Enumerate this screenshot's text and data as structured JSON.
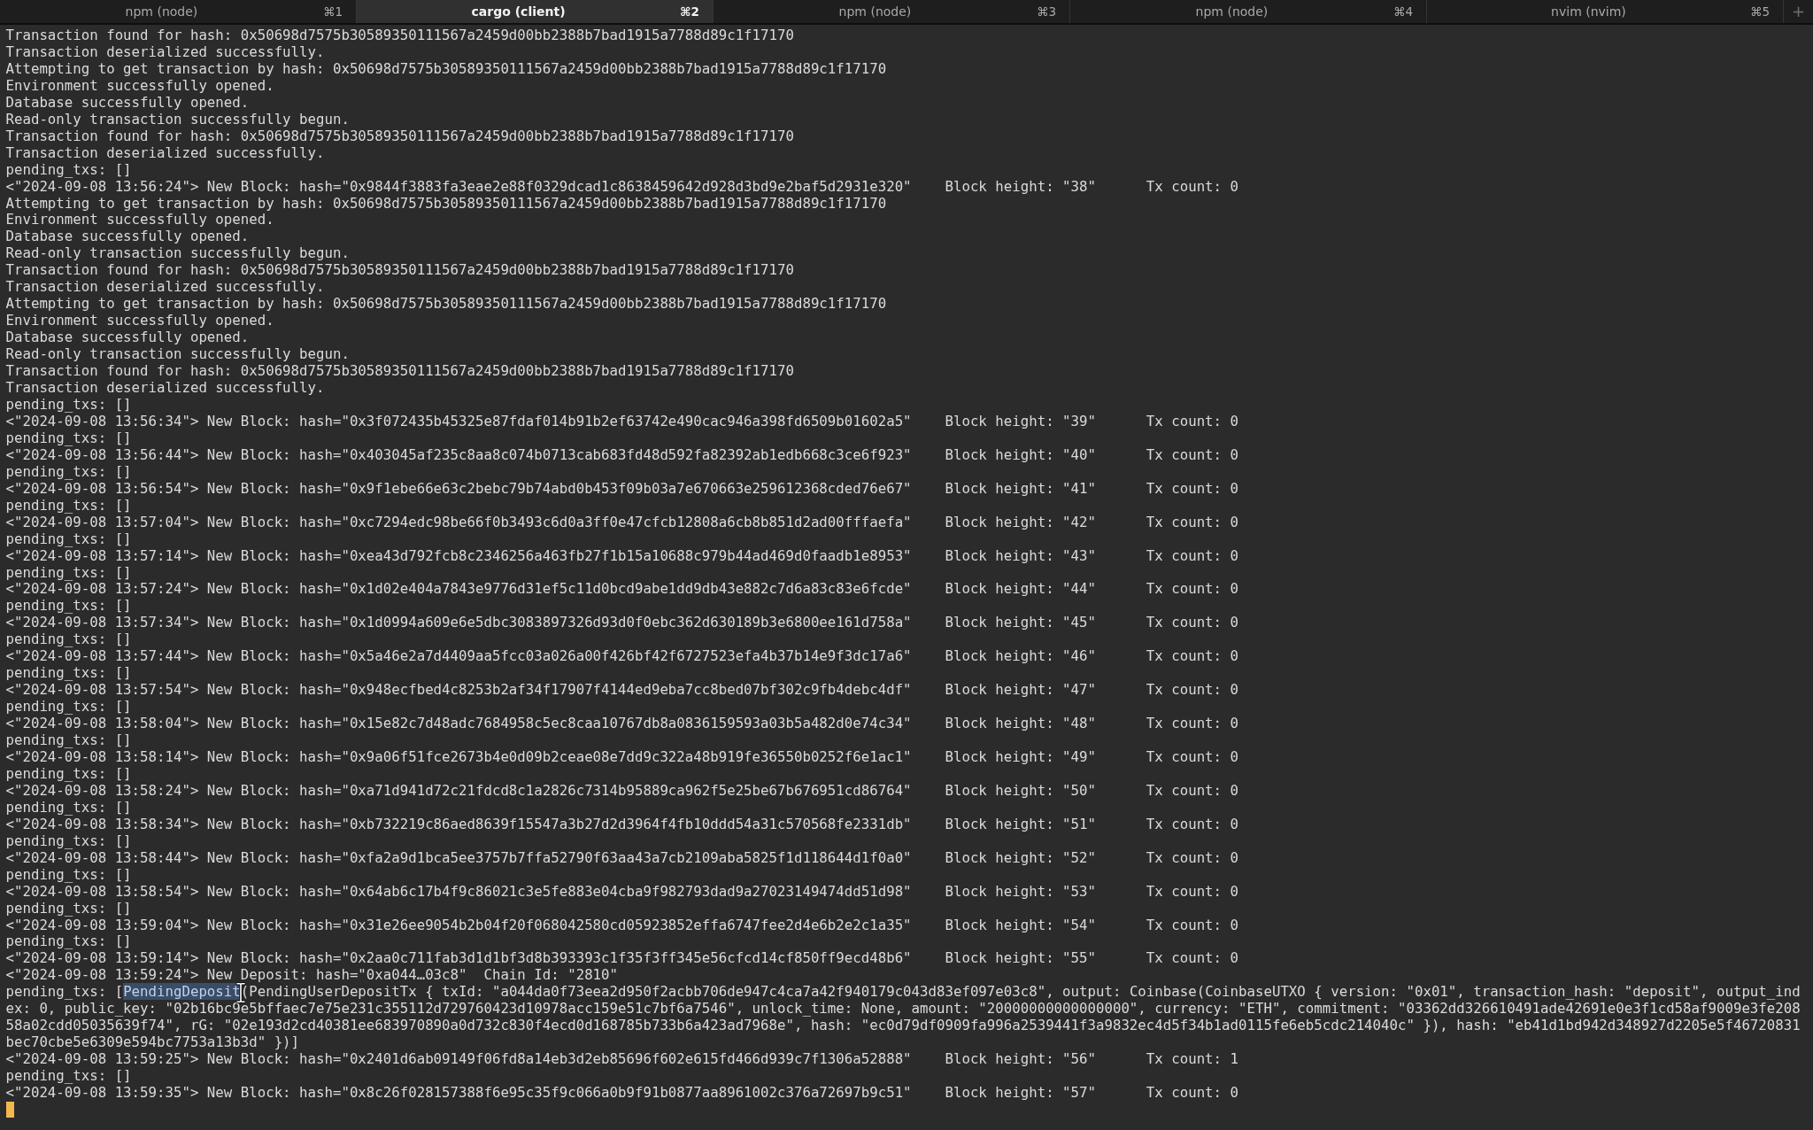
{
  "tabs": [
    {
      "title": "npm (node)",
      "shortcut": "⌘1",
      "selected": false
    },
    {
      "title": "cargo (client)",
      "shortcut": "⌘2",
      "selected": true
    },
    {
      "title": "npm (node)",
      "shortcut": "⌘3",
      "selected": false
    },
    {
      "title": "npm (node)",
      "shortcut": "⌘4",
      "selected": false
    },
    {
      "title": "nvim (nvim)",
      "shortcut": "⌘5",
      "selected": false
    }
  ],
  "new_tab": {
    "label": "+"
  },
  "terminal": {
    "lines": [
      {
        "kind": "text",
        "text": "Transaction found for hash: 0x50698d7575b30589350111567a2459d00bb2388b7bad1915a7788d89c1f17170"
      },
      {
        "kind": "text",
        "text": "Transaction deserialized successfully."
      },
      {
        "kind": "text",
        "text": "Attempting to get transaction by hash: 0x50698d7575b30589350111567a2459d00bb2388b7bad1915a7788d89c1f17170"
      },
      {
        "kind": "text",
        "text": "Environment successfully opened."
      },
      {
        "kind": "text",
        "text": "Database successfully opened."
      },
      {
        "kind": "text",
        "text": "Read-only transaction successfully begun."
      },
      {
        "kind": "text",
        "text": "Transaction found for hash: 0x50698d7575b30589350111567a2459d00bb2388b7bad1915a7788d89c1f17170"
      },
      {
        "kind": "text",
        "text": "Transaction deserialized successfully."
      },
      {
        "kind": "text",
        "text": "pending_txs: []"
      },
      {
        "kind": "text",
        "text": "<\"2024-09-08 13:56:24\"> New Block: hash=\"0x9844f3883fa3eae2e88f0329dcad1c8638459642d928d3bd9e2baf5d2931e320\"    Block height: \"38\"      Tx count: 0"
      },
      {
        "kind": "text",
        "text": "Attempting to get transaction by hash: 0x50698d7575b30589350111567a2459d00bb2388b7bad1915a7788d89c1f17170"
      },
      {
        "kind": "text",
        "text": "Environment successfully opened."
      },
      {
        "kind": "text",
        "text": "Database successfully opened."
      },
      {
        "kind": "text",
        "text": "Read-only transaction successfully begun."
      },
      {
        "kind": "text",
        "text": "Transaction found for hash: 0x50698d7575b30589350111567a2459d00bb2388b7bad1915a7788d89c1f17170"
      },
      {
        "kind": "text",
        "text": "Transaction deserialized successfully."
      },
      {
        "kind": "text",
        "text": "Attempting to get transaction by hash: 0x50698d7575b30589350111567a2459d00bb2388b7bad1915a7788d89c1f17170"
      },
      {
        "kind": "text",
        "text": "Environment successfully opened."
      },
      {
        "kind": "text",
        "text": "Database successfully opened."
      },
      {
        "kind": "text",
        "text": "Read-only transaction successfully begun."
      },
      {
        "kind": "text",
        "text": "Transaction found for hash: 0x50698d7575b30589350111567a2459d00bb2388b7bad1915a7788d89c1f17170"
      },
      {
        "kind": "text",
        "text": "Transaction deserialized successfully."
      },
      {
        "kind": "text",
        "text": "pending_txs: []"
      },
      {
        "kind": "text",
        "text": "<\"2024-09-08 13:56:34\"> New Block: hash=\"0x3f072435b45325e87fdaf014b91b2ef63742e490cac946a398fd6509b01602a5\"    Block height: \"39\"      Tx count: 0"
      },
      {
        "kind": "text",
        "text": "pending_txs: []"
      },
      {
        "kind": "text",
        "text": "<\"2024-09-08 13:56:44\"> New Block: hash=\"0x403045af235c8aa8c074b0713cab683fd48d592fa82392ab1edb668c3ce6f923\"    Block height: \"40\"      Tx count: 0"
      },
      {
        "kind": "text",
        "text": "pending_txs: []"
      },
      {
        "kind": "text",
        "text": "<\"2024-09-08 13:56:54\"> New Block: hash=\"0x9f1ebe66e63c2bebc79b74abd0b453f09b03a7e670663e259612368cded76e67\"    Block height: \"41\"      Tx count: 0"
      },
      {
        "kind": "text",
        "text": "pending_txs: []"
      },
      {
        "kind": "text",
        "text": "<\"2024-09-08 13:57:04\"> New Block: hash=\"0xc7294edc98be66f0b3493c6d0a3ff0e47cfcb12808a6cb8b851d2ad00fffaefa\"    Block height: \"42\"      Tx count: 0"
      },
      {
        "kind": "text",
        "text": "pending_txs: []"
      },
      {
        "kind": "text",
        "text": "<\"2024-09-08 13:57:14\"> New Block: hash=\"0xea43d792fcb8c2346256a463fb27f1b15a10688c979b44ad469d0faadb1e8953\"    Block height: \"43\"      Tx count: 0"
      },
      {
        "kind": "text",
        "text": "pending_txs: []"
      },
      {
        "kind": "text",
        "text": "<\"2024-09-08 13:57:24\"> New Block: hash=\"0x1d02e404a7843e9776d31ef5c11d0bcd9abe1dd9db43e882c7d6a83c83e6fcde\"    Block height: \"44\"      Tx count: 0"
      },
      {
        "kind": "text",
        "text": "pending_txs: []"
      },
      {
        "kind": "text",
        "text": "<\"2024-09-08 13:57:34\"> New Block: hash=\"0x1d0994a609e6e5dbc3083897326d93d0f0ebc362d630189b3e6800ee161d758a\"    Block height: \"45\"      Tx count: 0"
      },
      {
        "kind": "text",
        "text": "pending_txs: []"
      },
      {
        "kind": "text",
        "text": "<\"2024-09-08 13:57:44\"> New Block: hash=\"0x5a46e2a7d4409aa5fcc03a026a00f426bf42f6727523efa4b37b14e9f3dc17a6\"    Block height: \"46\"      Tx count: 0"
      },
      {
        "kind": "text",
        "text": "pending_txs: []"
      },
      {
        "kind": "text",
        "text": "<\"2024-09-08 13:57:54\"> New Block: hash=\"0x948ecfbed4c8253b2af34f17907f4144ed9eba7cc8bed07bf302c9fb4debc4df\"    Block height: \"47\"      Tx count: 0"
      },
      {
        "kind": "text",
        "text": "pending_txs: []"
      },
      {
        "kind": "text",
        "text": "<\"2024-09-08 13:58:04\"> New Block: hash=\"0x15e82c7d48adc7684958c5ec8caa10767db8a0836159593a03b5a482d0e74c34\"    Block height: \"48\"      Tx count: 0"
      },
      {
        "kind": "text",
        "text": "pending_txs: []"
      },
      {
        "kind": "text",
        "text": "<\"2024-09-08 13:58:14\"> New Block: hash=\"0x9a06f51fce2673b4e0d09b2ceae08e7dd9c322a48b919fe36550b0252f6e1ac1\"    Block height: \"49\"      Tx count: 0"
      },
      {
        "kind": "text",
        "text": "pending_txs: []"
      },
      {
        "kind": "text",
        "text": "<\"2024-09-08 13:58:24\"> New Block: hash=\"0xa71d941d72c21fdcd8c1a2826c7314b95889ca962f5e25be67b676951cd86764\"    Block height: \"50\"      Tx count: 0"
      },
      {
        "kind": "text",
        "text": "pending_txs: []"
      },
      {
        "kind": "text",
        "text": "<\"2024-09-08 13:58:34\"> New Block: hash=\"0xb732219c86aed8639f15547a3b27d2d3964f4fb10ddd54a31c570568fe2331db\"    Block height: \"51\"      Tx count: 0"
      },
      {
        "kind": "text",
        "text": "pending_txs: []"
      },
      {
        "kind": "text",
        "text": "<\"2024-09-08 13:58:44\"> New Block: hash=\"0xfa2a9d1bca5ee3757b7ffa52790f63aa43a7cb2109aba5825f1d118644d1f0a0\"    Block height: \"52\"      Tx count: 0"
      },
      {
        "kind": "text",
        "text": "pending_txs: []"
      },
      {
        "kind": "text",
        "text": "<\"2024-09-08 13:58:54\"> New Block: hash=\"0x64ab6c17b4f9c86021c3e5fe883e04cba9f982793dad9a27023149474dd51d98\"    Block height: \"53\"      Tx count: 0"
      },
      {
        "kind": "text",
        "text": "pending_txs: []"
      },
      {
        "kind": "text",
        "text": "<\"2024-09-08 13:59:04\"> New Block: hash=\"0x31e26ee9054b2b04f20f068042580cd05923852effa6747fee2d4e6b2e2c1a35\"    Block height: \"54\"      Tx count: 0"
      },
      {
        "kind": "text",
        "text": "pending_txs: []"
      },
      {
        "kind": "text",
        "text": "<\"2024-09-08 13:59:14\"> New Block: hash=\"0x2aa0c711fab3d1d1bf3d8b393393c1f35f3ff345e56cfcd14cf850ff9ecd48b6\"    Block height: \"55\"      Tx count: 0"
      },
      {
        "kind": "text",
        "text": "<\"2024-09-08 13:59:24\"> New Deposit: hash=\"0xa044…03c8\"  Chain Id: \"2810\""
      },
      {
        "kind": "selection",
        "before": "pending_txs: [",
        "selected_text": "PendingDeposit",
        "after": "(PendingUserDepositTx { txId: \"a044da0f73eea2d950f2acbb706de947c4ca7a42f940179c043d83ef097e03c8\", output: Coinbase(CoinbaseUTXO { version: \"0x01\", transaction_hash: \"deposit\", output_index: 0, public_key: \"02b16bc9e5bffaec7e75e231c355112d729760423d10978acc159e51c7bf6a7546\", unlock_time: None, amount: \"20000000000000000\", currency: \"ETH\", commitment: \"03362dd326610491ade42691e0e3f1cd58af9009e3fe20858a02cdd05035639f74\", rG: \"02e193d2cd40381ee683970890a0d732c830f4ecd0d168785b733b6a423ad7968e\", hash: \"ec0d79df0909fa996a2539441f3a9832ec4d5f34b1ad0115fe6eb5cdc214040c\" }), hash: \"eb41d1bd942d348927d2205e5f46720831bec70cbe5e6309e594bc7753a13b3d\" })]"
      },
      {
        "kind": "text",
        "text": "<\"2024-09-08 13:59:25\"> New Block: hash=\"0x2401d6ab09149f06fd8a14eb3d2eb85696f602e615fd466d939c7f1306a52888\"    Block height: \"56\"      Tx count: 1"
      },
      {
        "kind": "text",
        "text": "pending_txs: []"
      },
      {
        "kind": "text",
        "text": "<\"2024-09-08 13:59:35\"> New Block: hash=\"0x8c26f028157388f6e95c35f9c066a0b9f91b0877aa8961002c376a72697b9c51\"    Block height: \"57\"      Tx count: 0"
      }
    ]
  }
}
